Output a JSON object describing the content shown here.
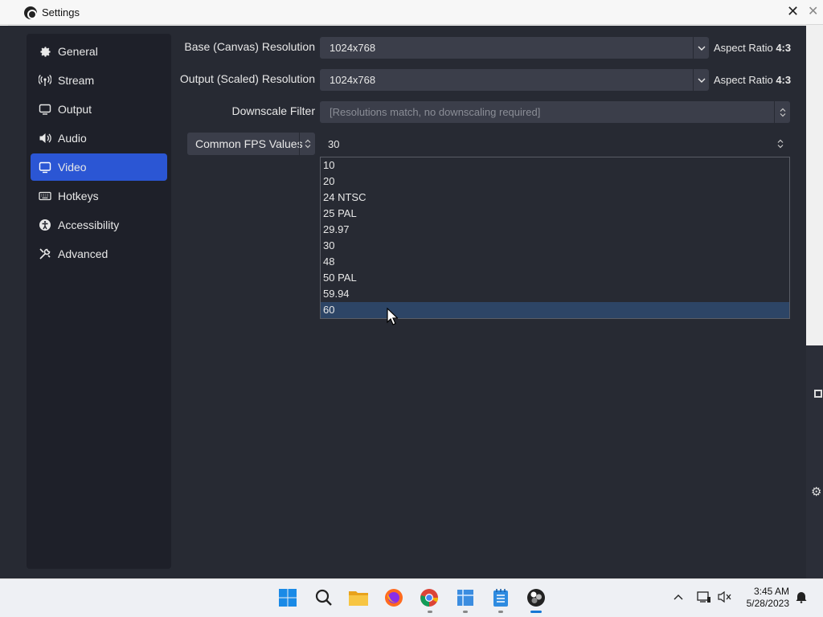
{
  "window": {
    "title": "Settings"
  },
  "sidebar": {
    "items": [
      {
        "label": "General",
        "icon": "gear-icon"
      },
      {
        "label": "Stream",
        "icon": "antenna-icon"
      },
      {
        "label": "Output",
        "icon": "monitor-output-icon"
      },
      {
        "label": "Audio",
        "icon": "speaker-icon"
      },
      {
        "label": "Video",
        "icon": "monitor-icon",
        "active": true
      },
      {
        "label": "Hotkeys",
        "icon": "keyboard-icon"
      },
      {
        "label": "Accessibility",
        "icon": "accessibility-icon"
      },
      {
        "label": "Advanced",
        "icon": "wrench-icon"
      }
    ]
  },
  "video": {
    "base_label": "Base (Canvas) Resolution",
    "base_value": "1024x768",
    "base_aspect_prefix": "Aspect Ratio",
    "base_aspect": "4:3",
    "output_label": "Output (Scaled) Resolution",
    "output_value": "1024x768",
    "output_aspect_prefix": "Aspect Ratio",
    "output_aspect": "4:3",
    "downscale_label": "Downscale Filter",
    "downscale_value": "[Resolutions match, no downscaling required]",
    "fps_type": "Common FPS Values",
    "fps_value": "30",
    "fps_options": [
      "10",
      "20",
      "24 NTSC",
      "25 PAL",
      "29.97",
      "30",
      "48",
      "50 PAL",
      "59.94",
      "60"
    ],
    "fps_highlighted": "60"
  },
  "taskbar": {
    "time": "3:45 AM",
    "date": "5/28/2023"
  },
  "colors": {
    "accent": "#2b56d4",
    "window_bg": "#272a33",
    "sidebar_bg": "#1e2029",
    "control_bg": "#3b3e4a",
    "highlight": "#2d4566"
  }
}
